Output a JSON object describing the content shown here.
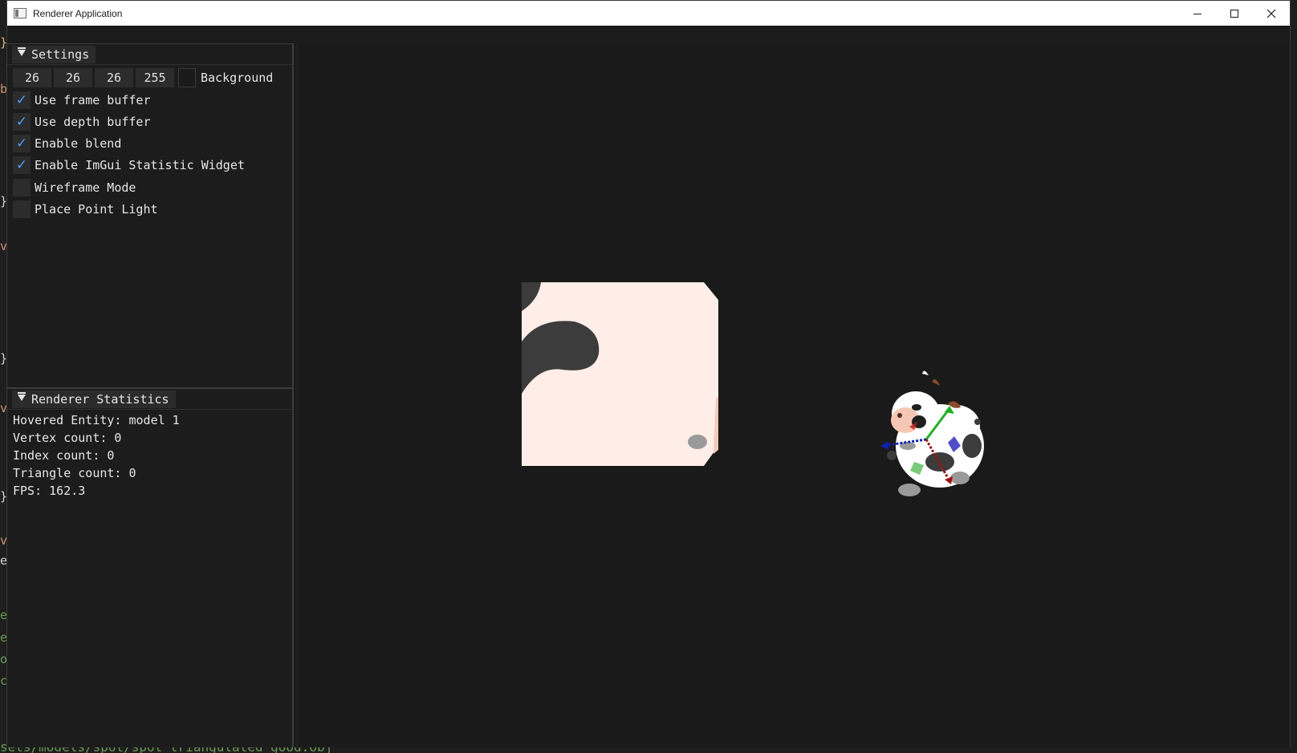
{
  "window": {
    "title": "Renderer Application",
    "minimize_icon": "minimize-icon",
    "maximize_icon": "maximize-icon",
    "close_icon": "close-icon"
  },
  "background_editor": {
    "bottom_text": "sets/models/spot/spot_triangulated_good.obj"
  },
  "settings_panel": {
    "title": "Settings",
    "background_color": {
      "r": "26",
      "g": "26",
      "b": "26",
      "a": "255",
      "label": "Background",
      "swatch_hex": "#1a1a1a"
    },
    "checkboxes": [
      {
        "label": "Use frame buffer",
        "checked": true
      },
      {
        "label": "Use depth buffer",
        "checked": true
      },
      {
        "label": "Enable blend",
        "checked": true
      },
      {
        "label": "Enable ImGui Statistic Widget",
        "checked": true
      },
      {
        "label": "Wireframe Mode",
        "checked": false
      },
      {
        "label": "Place Point Light",
        "checked": false
      }
    ]
  },
  "stats_panel": {
    "title": "Renderer Statistics",
    "lines": [
      "Hovered Entity: model 1",
      "Vertex count: 0",
      "Index count: 0",
      "Triangle count: 0",
      "FPS: 162.3"
    ]
  },
  "colors": {
    "accent_check": "#4a9fff",
    "panel_bg": "#1c1c1c",
    "viewport_bg": "#1a1a1a",
    "cow_skin": "#ffeee8",
    "cow_spot": "#3c3c3c",
    "gizmo_x": "#b01010",
    "gizmo_y": "#20b020",
    "gizmo_z": "#1020b0"
  }
}
